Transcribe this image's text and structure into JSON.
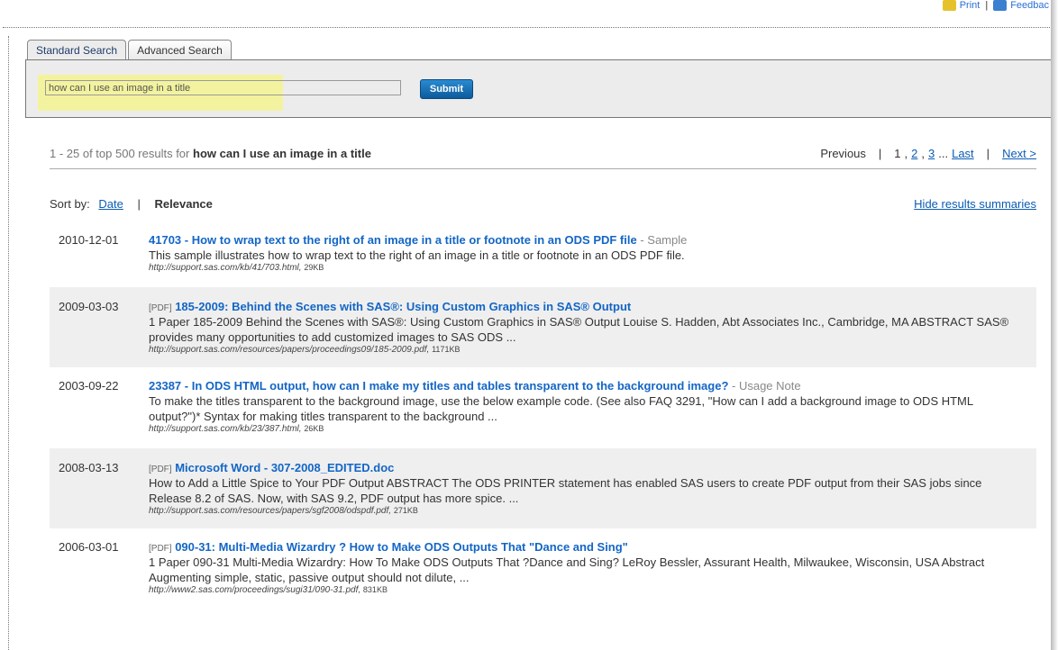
{
  "topbar": {
    "print": "Print",
    "feedback": "Feedbac"
  },
  "tabs": [
    {
      "label": "Standard Search"
    },
    {
      "label": "Advanced Search"
    }
  ],
  "search": {
    "value": "how can I use an image in a title",
    "submit": "Submit"
  },
  "summary": {
    "prefix": "1 - 25 of top 500 results for",
    "query": "how can I use an image in a title"
  },
  "pager": {
    "previous": "Previous",
    "sep": "|",
    "current": "1",
    "p2": "2",
    "p3": "3",
    "ellipsis": "...",
    "last": "Last",
    "next": "Next >"
  },
  "sort": {
    "label": "Sort by:",
    "date": "Date",
    "sep": "|",
    "relevance": "Relevance",
    "hide": "Hide results summaries"
  },
  "results": [
    {
      "date": "2010-12-01",
      "pdf": "",
      "title": "41703 - How to wrap text to the right of an image in a title or footnote in an ODS PDF file",
      "type": "- Sample",
      "desc": "This sample illustrates how to wrap text to the right of an image in a title or footnote in an ODS PDF file.",
      "url": "http://support.sas.com/kb/41/703.html,",
      "size": "29KB"
    },
    {
      "date": "2009-03-03",
      "pdf": "[PDF]",
      "title": "185-2009: Behind the Scenes with SAS®: Using Custom Graphics in SAS® Output",
      "type": "",
      "desc": "1 Paper 185-2009 Behind the Scenes with SAS®: Using Custom Graphics in SAS® Output Louise S. Hadden, Abt Associates Inc., Cambridge, MA ABSTRACT SAS® provides many opportunities to add customized images to SAS ODS ...",
      "url": "http://support.sas.com/resources/papers/proceedings09/185-2009.pdf,",
      "size": "1171KB"
    },
    {
      "date": "2003-09-22",
      "pdf": "",
      "title": "23387 - In ODS HTML output, how can I make my titles and tables transparent to the background image?",
      "type": "- Usage Note",
      "desc": "To make the titles transparent to the background image, use the below example code. (See also FAQ 3291, \"How can I add a background image to ODS HTML output?\")* Syntax for making titles transparent to the background ...",
      "url": "http://support.sas.com/kb/23/387.html,",
      "size": "26KB"
    },
    {
      "date": "2008-03-13",
      "pdf": "[PDF]",
      "title": "Microsoft Word - 307-2008_EDITED.doc",
      "type": "",
      "desc": "How to Add a Little Spice to Your PDF Output ABSTRACT The ODS PRINTER statement has enabled SAS users to create PDF output from their SAS jobs since Release 8.2 of SAS. Now, with SAS 9.2, PDF output has more spice. ...",
      "url": "http://support.sas.com/resources/papers/sgf2008/odspdf.pdf,",
      "size": "271KB"
    },
    {
      "date": "2006-03-01",
      "pdf": "[PDF]",
      "title": "090-31: Multi-Media Wizardry ? How to Make ODS Outputs That \"Dance and Sing\"",
      "type": "",
      "desc": "1 Paper 090-31 Multi-Media Wizardry: How To Make ODS Outputs That ?Dance and Sing? LeRoy Bessler, Assurant Health, Milwaukee, Wisconsin, USA Abstract Augmenting simple, static, passive output should not dilute, ...",
      "url": "http://www2.sas.com/proceedings/sugi31/090-31.pdf,",
      "size": "831KB"
    }
  ]
}
